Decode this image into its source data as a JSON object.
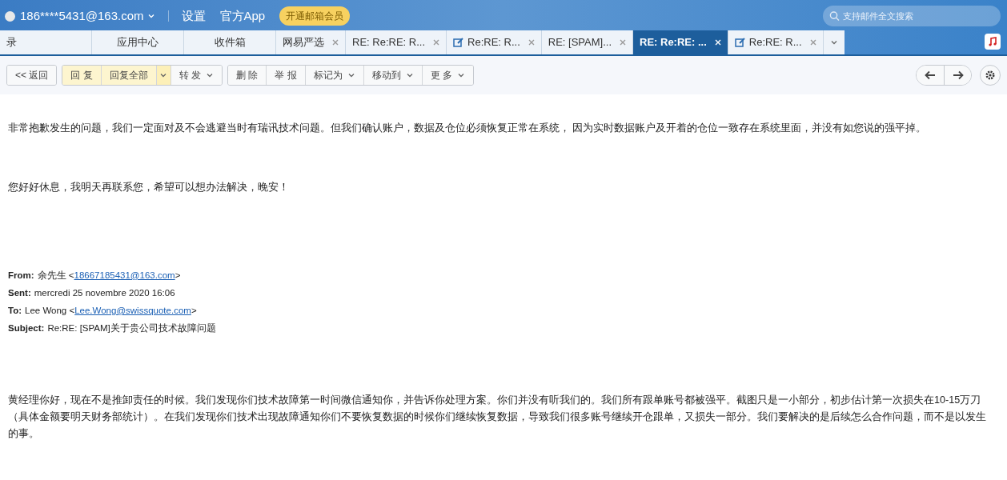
{
  "topbar": {
    "account": "186****5431@163.com",
    "links": [
      "设置",
      "官方App"
    ],
    "vip_badge": "开通邮箱会员",
    "search": {
      "placeholder": "支持邮件全文搜索"
    }
  },
  "tabs": [
    {
      "label": "录",
      "selected": false,
      "closable": false,
      "draft": false
    },
    {
      "label": "应用中心",
      "selected": false,
      "closable": false,
      "draft": false
    },
    {
      "label": "收件箱",
      "selected": false,
      "closable": false,
      "draft": false
    },
    {
      "label": "网易严选",
      "selected": false,
      "closable": true,
      "draft": false
    },
    {
      "label": "RE: Re:RE: R...",
      "selected": false,
      "closable": true,
      "draft": false
    },
    {
      "label": "Re:RE: R...",
      "selected": false,
      "closable": true,
      "draft": true
    },
    {
      "label": "RE: [SPAM]...",
      "selected": false,
      "closable": true,
      "draft": false
    },
    {
      "label": "RE: Re:RE: ...",
      "selected": true,
      "closable": true,
      "draft": false
    },
    {
      "label": "Re:RE: R...",
      "selected": false,
      "closable": true,
      "draft": true
    }
  ],
  "toolbar": [
    [
      {
        "label": "<< 返回",
        "highlight": false,
        "dropdown": false
      }
    ],
    [
      {
        "label": "回 复",
        "highlight": true,
        "dropdown": false
      },
      {
        "label": "回复全部",
        "highlight": true,
        "dropdown": true
      },
      {
        "label": "转 发",
        "highlight": false,
        "dropdown": true
      }
    ],
    [
      {
        "label": "删 除",
        "highlight": false,
        "dropdown": false
      },
      {
        "label": "举 报",
        "highlight": false,
        "dropdown": false
      },
      {
        "label": "标记为",
        "highlight": false,
        "dropdown": true
      },
      {
        "label": "移动到",
        "highlight": false,
        "dropdown": true
      },
      {
        "label": "更 多",
        "highlight": false,
        "dropdown": true
      }
    ]
  ],
  "body": {
    "paragraphs": [
      "非常抱歉发生的问题，我们一定面对及不会逃避当时有瑞讯技术问题。但我们确认账户，数据及仓位必须恢复正常在系统， 因为实时数据账户及开着的仓位一致存在系统里面，并没有如您说的强平掉。",
      "您好好休息，我明天再联系您，希望可以想办法解决，晚安！"
    ],
    "quoted_header": [
      {
        "label": "From:",
        "text": "余先生 <",
        "link": "18667185431@163.com",
        "after": ">"
      },
      {
        "label": "Sent:",
        "text": "mercredi 25 novembre 2020 16:06"
      },
      {
        "label": "To:",
        "text": "Lee Wong <",
        "link": "Lee.Wong@swissquote.com",
        "after": ">"
      },
      {
        "label": "Subject:",
        "text": "Re:RE: [SPAM]关于贵公司技术故障问题"
      }
    ],
    "quoted_paragraph": "黄经理你好，现在不是推卸责任的时候。我们发现你们技术故障第一时间微信通知你，并告诉你处理方案。你们并没有听我们的。我们所有跟单账号都被强平。截图只是一小部分，初步估计第一次损失在10-15万刀（具体金额要明天财务部统计）。在我们发现你们技术出现故障通知你们不要恢复数据的时候你们继续恢复数据，导致我们很多账号继续开仓跟单，又损失一部分。我们要解决的是后续怎么合作问题，而不是以发生的事。"
  }
}
